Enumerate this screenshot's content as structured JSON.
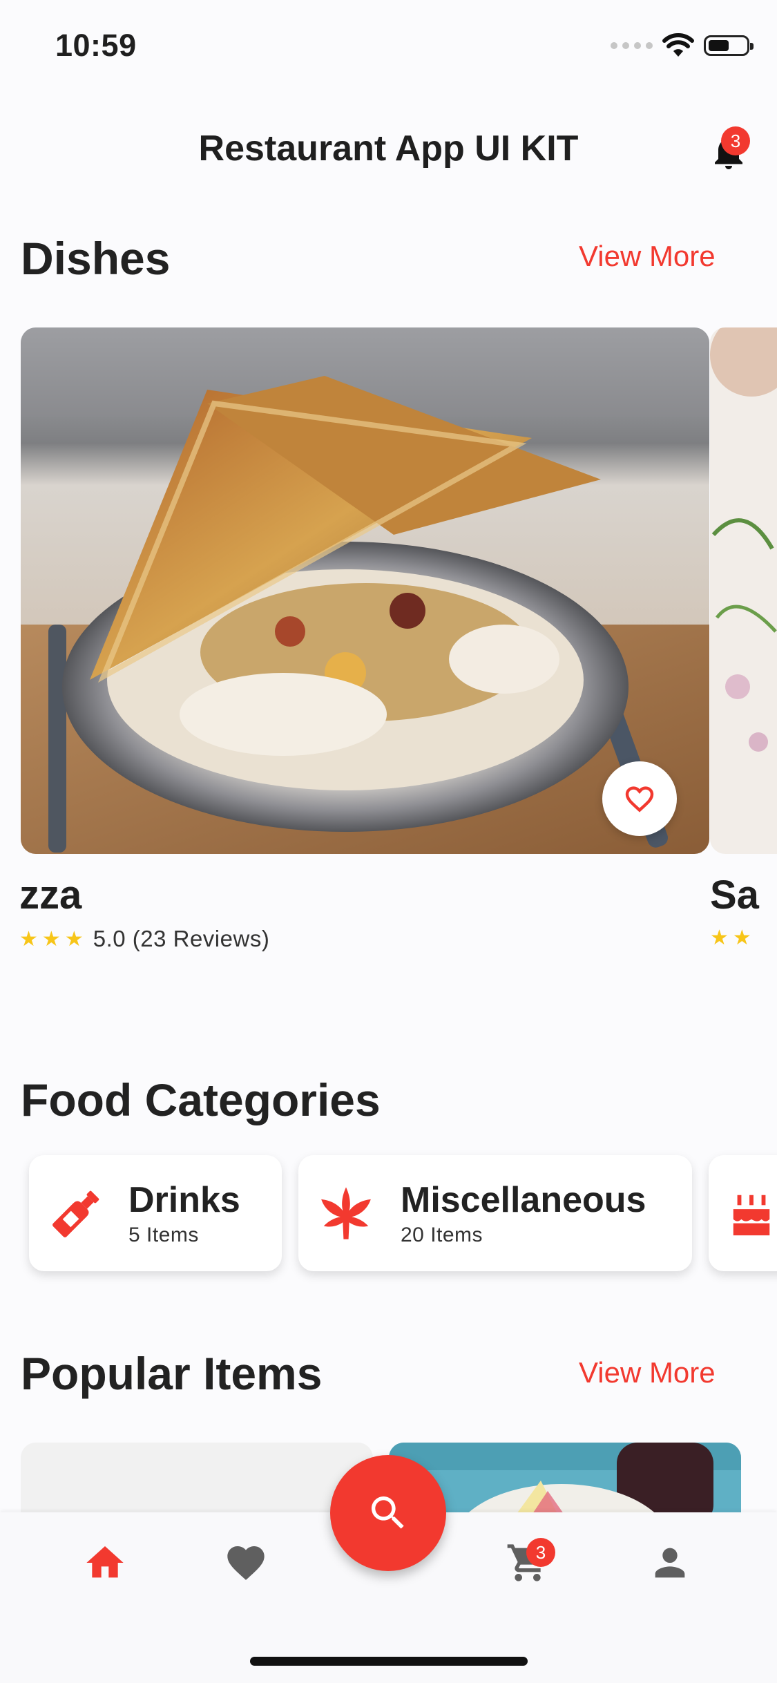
{
  "status_bar": {
    "time": "10:59",
    "battery_level_pct": 55
  },
  "app_bar": {
    "title": "Restaurant App UI KIT",
    "notification_count": "3",
    "icon": "bell-icon"
  },
  "dishes": {
    "title": "Dishes",
    "view_more": "View More",
    "items": [
      {
        "name": "zza",
        "rating": "5.0 (23 Reviews)",
        "stars": 3,
        "favorite_icon": "heart-outline-icon"
      },
      {
        "name": "Sa",
        "stars": 2
      }
    ]
  },
  "categories": {
    "title": "Food Categories",
    "items": [
      {
        "name": "Drinks",
        "count": "5 Items",
        "icon": "bottle-icon"
      },
      {
        "name": "Miscellaneous",
        "count": "20 Items",
        "icon": "leaf-icon"
      },
      {
        "name": "",
        "count": "",
        "icon": "cake-icon"
      }
    ]
  },
  "popular": {
    "title": "Popular Items",
    "view_more": "View More"
  },
  "bottom_nav": {
    "items": [
      "home-icon",
      "heart-icon",
      "search-icon",
      "cart-icon",
      "person-icon"
    ],
    "cart_count": "3",
    "active": "home"
  },
  "colors": {
    "accent": "#f2392f",
    "star": "#f7c518",
    "background": "#fbfbfd",
    "inactive_icon": "#5f5f5f"
  }
}
